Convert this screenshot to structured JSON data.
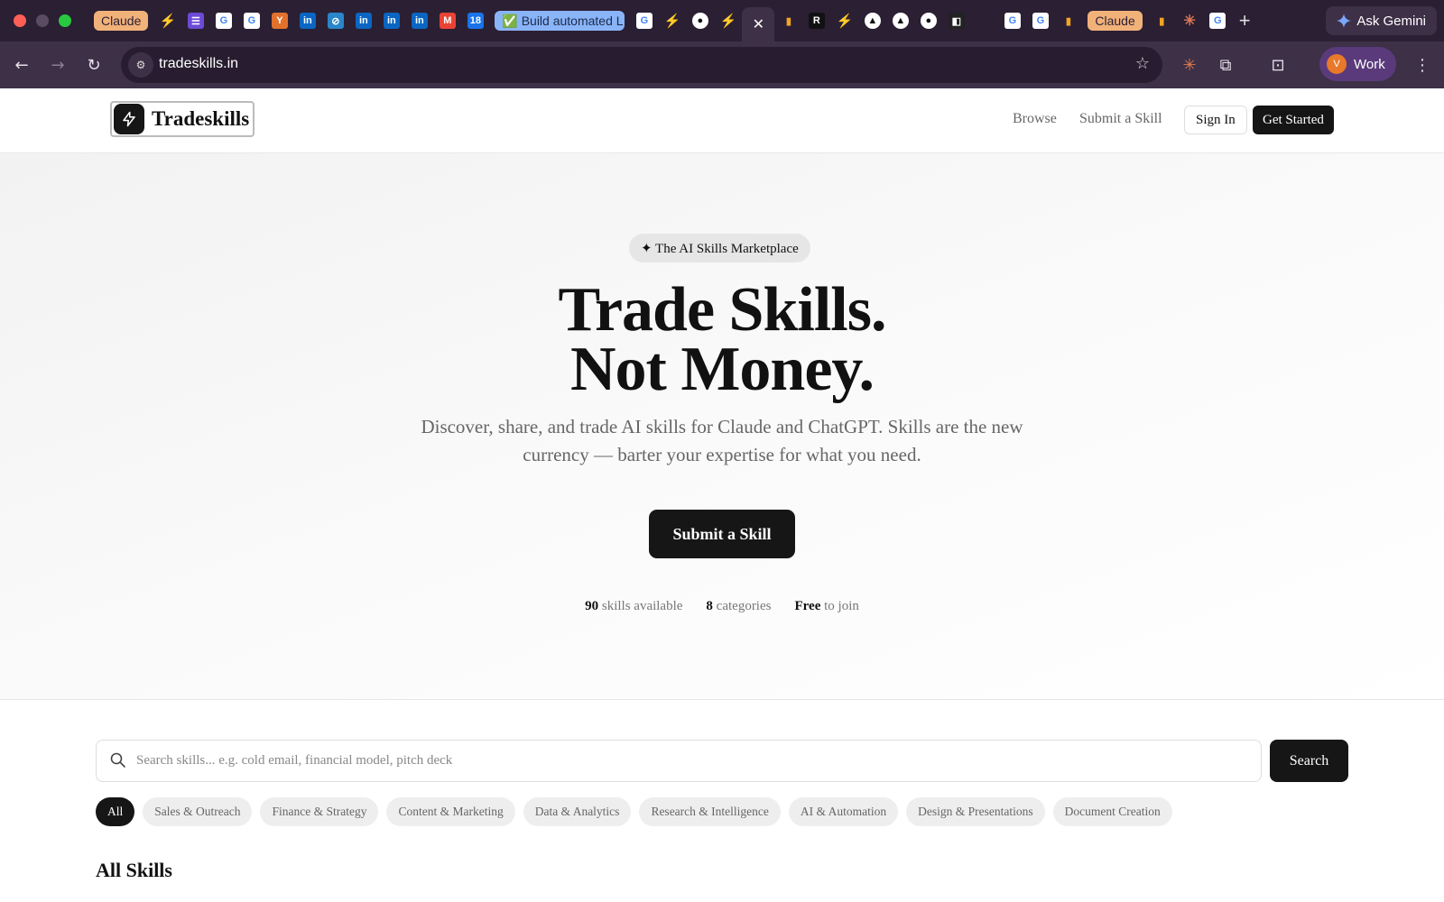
{
  "browser": {
    "tabs": [
      {
        "type": "claude",
        "label": "Claude",
        "icon": "claude-tab"
      },
      {
        "type": "fav",
        "icon": "bolt-icon",
        "color": "#35c46b",
        "glyph": "⚡"
      },
      {
        "type": "fav",
        "icon": "list-icon",
        "color": "#6c4ad6",
        "glyph": "☰"
      },
      {
        "type": "fav",
        "icon": "google-icon",
        "color": "#ffffff",
        "glyph": "G"
      },
      {
        "type": "fav",
        "icon": "google-icon",
        "color": "#ffffff",
        "glyph": "G"
      },
      {
        "type": "fav",
        "icon": "y-icon",
        "color": "#e2712c",
        "glyph": "Y"
      },
      {
        "type": "fav",
        "icon": "linkedin-icon",
        "color": "#0a66c2",
        "glyph": "in"
      },
      {
        "type": "fav",
        "icon": "compass-icon",
        "color": "#2a86c9",
        "glyph": "⊘"
      },
      {
        "type": "fav",
        "icon": "linkedin-icon",
        "color": "#0a66c2",
        "glyph": "in"
      },
      {
        "type": "fav",
        "icon": "linkedin-icon",
        "color": "#0a66c2",
        "glyph": "in"
      },
      {
        "type": "fav",
        "icon": "linkedin-icon",
        "color": "#0a66c2",
        "glyph": "in"
      },
      {
        "type": "fav",
        "icon": "gmail-icon",
        "color": "#ea4335",
        "glyph": "M"
      },
      {
        "type": "fav",
        "icon": "sheet-icon",
        "color": "#1a73e8",
        "glyph": "18"
      },
      {
        "type": "group",
        "label": "✅ Build automated L",
        "icon": "tab-group"
      },
      {
        "type": "fav",
        "icon": "google-icon",
        "color": "#ffffff",
        "glyph": "G"
      },
      {
        "type": "fav",
        "icon": "bolt-icon",
        "color": "#35c46b",
        "glyph": "⚡"
      },
      {
        "type": "fav",
        "icon": "github-icon",
        "color": "#111111",
        "glyph": "●"
      },
      {
        "type": "fav",
        "icon": "bolt-icon",
        "color": "#35c46b",
        "glyph": "⚡"
      },
      {
        "type": "active",
        "label": "✕",
        "icon": "close-icon"
      },
      {
        "type": "fav",
        "icon": "analytics-icon",
        "color": "#f4a521",
        "glyph": "▮"
      },
      {
        "type": "fav",
        "icon": "r-icon",
        "color": "#111111",
        "glyph": "R"
      },
      {
        "type": "fav",
        "icon": "bolt-icon",
        "color": "#35c46b",
        "glyph": "⚡"
      },
      {
        "type": "fav",
        "icon": "vercel-icon",
        "color": "#111111",
        "glyph": "▲"
      },
      {
        "type": "fav",
        "icon": "vercel-icon",
        "color": "#111111",
        "glyph": "▲"
      },
      {
        "type": "fav",
        "icon": "github-icon",
        "color": "#111111",
        "glyph": "●"
      },
      {
        "type": "fav",
        "icon": "app-icon",
        "color": "#222222",
        "glyph": "◧"
      },
      {
        "type": "fav",
        "icon": "blank-icon",
        "color": "#2b1f33",
        "glyph": ""
      },
      {
        "type": "fav",
        "icon": "google-icon",
        "color": "#ffffff",
        "glyph": "G"
      },
      {
        "type": "fav",
        "icon": "google-icon",
        "color": "#ffffff",
        "glyph": "G"
      },
      {
        "type": "fav",
        "icon": "analytics-icon",
        "color": "#f4a521",
        "glyph": "▮"
      },
      {
        "type": "claude",
        "label": "Claude",
        "icon": "claude-tab"
      },
      {
        "type": "fav",
        "icon": "analytics-icon",
        "color": "#f4a521",
        "glyph": "▮"
      },
      {
        "type": "fav",
        "icon": "claude-icon",
        "color": "#d97757",
        "glyph": "✳"
      },
      {
        "type": "fav",
        "icon": "google-icon",
        "color": "#ffffff",
        "glyph": "G"
      }
    ],
    "new_tab": "+",
    "gemini_label": "Ask Gemini",
    "url": "tradeskills.in",
    "profile_initial": "V",
    "profile_label": "Work"
  },
  "header": {
    "brand": "Tradeskills",
    "nav": [
      "Browse",
      "Submit a Skill"
    ],
    "sign_in": "Sign In",
    "get_started": "Get Started"
  },
  "hero": {
    "pill": "✦ The AI Skills Marketplace",
    "headline_1": "Trade Skills.",
    "headline_2": "Not Money.",
    "subtitle_1": "Discover, share, and trade AI skills for Claude and ChatGPT. Skills are the new",
    "subtitle_2": "currency — barter your expertise for what you need.",
    "cta": "Submit a Skill",
    "stats": [
      {
        "value": "90",
        "label": "skills available"
      },
      {
        "value": "8",
        "label": "categories"
      },
      {
        "value": "Free",
        "label": "to join"
      }
    ]
  },
  "search": {
    "placeholder": "Search skills... e.g. cold email, financial model, pitch deck",
    "value": "",
    "button": "Search"
  },
  "categories": [
    "All",
    "Sales & Outreach",
    "Finance & Strategy",
    "Content & Marketing",
    "Data & Analytics",
    "Research & Intelligence",
    "AI & Automation",
    "Design & Presentations",
    "Document Creation"
  ],
  "active_category": "All",
  "section_title": "All Skills"
}
